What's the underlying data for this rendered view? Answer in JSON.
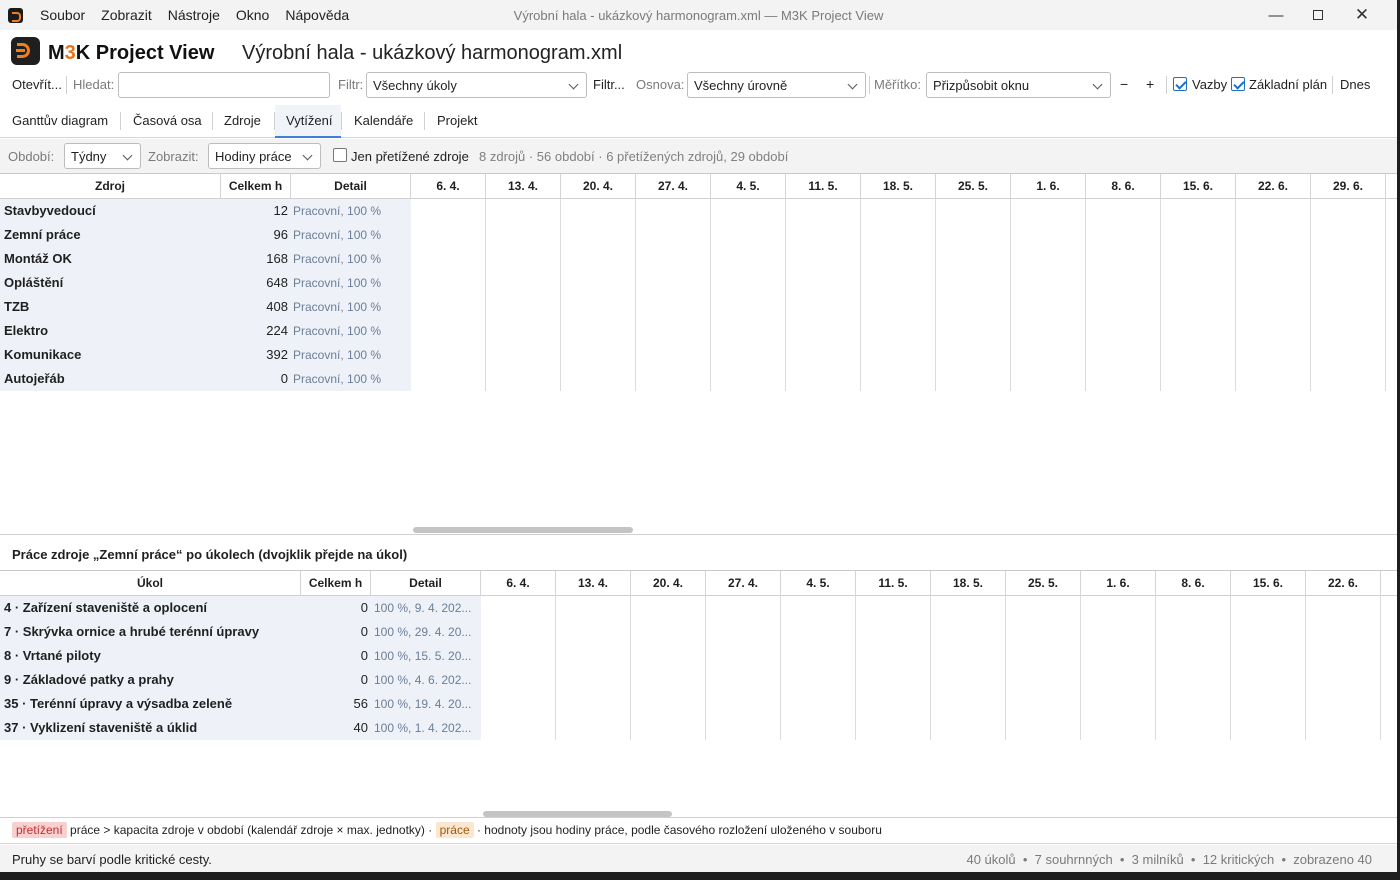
{
  "window": {
    "title": "Výrobní hala - ukázkový harmonogram.xml — M3K Project View",
    "menu": [
      "Soubor",
      "Zobrazit",
      "Nástroje",
      "Okno",
      "Nápověda"
    ]
  },
  "header": {
    "brand_prefix": "M",
    "brand_digit": "3",
    "brand_suffix": "K Project View",
    "document": "Výrobní hala - ukázkový harmonogram.xml"
  },
  "toolbar": {
    "open_label": "Otevřít...",
    "search_label": "Hledat:",
    "search_value": "",
    "filter_label": "Filtr:",
    "filter_value": "Všechny úkoly",
    "filter_more": "Filtr...",
    "outline_label": "Osnova:",
    "outline_value": "Všechny úrovně",
    "scale_label": "Měřítko:",
    "scale_value": "Přizpůsobit oknu",
    "zoom_out": "−",
    "zoom_in": "+",
    "links_label": "Vazby",
    "links_checked": true,
    "baseline_label": "Základní plán",
    "baseline_checked": true,
    "today_label": "Dnes"
  },
  "tabs": [
    "Ganttův diagram",
    "Časová osa",
    "Zdroje",
    "Vytížení",
    "Kalendáře",
    "Projekt"
  ],
  "active_tab": "Vytížení",
  "filterbar": {
    "period_label": "Období:",
    "period_value": "Týdny",
    "show_label": "Zobrazit:",
    "show_value": "Hodiny práce",
    "overloaded_only_label": "Jen přetížené zdroje",
    "overloaded_only_checked": false,
    "info": "8 zdrojů · 56 období · 6 přetížených zdrojů, 29 období"
  },
  "resources_grid": {
    "columns": [
      "Zdroj",
      "Celkem h",
      "Detail"
    ],
    "periods": [
      "6. 4.",
      "13. 4.",
      "20. 4.",
      "27. 4.",
      "4. 5.",
      "11. 5.",
      "18. 5.",
      "25. 5.",
      "1. 6.",
      "8. 6.",
      "15. 6.",
      "22. 6.",
      "29. 6."
    ],
    "rows": [
      {
        "name": "Stavbyvedoucí",
        "total": "12",
        "detail": "Pracovní, 100 %"
      },
      {
        "name": "Zemní práce",
        "total": "96",
        "detail": "Pracovní, 100 %"
      },
      {
        "name": "Montáž OK",
        "total": "168",
        "detail": "Pracovní, 100 %"
      },
      {
        "name": "Opláštění",
        "total": "648",
        "detail": "Pracovní, 100 %"
      },
      {
        "name": "TZB",
        "total": "408",
        "detail": "Pracovní, 100 %"
      },
      {
        "name": "Elektro",
        "total": "224",
        "detail": "Pracovní, 100 %"
      },
      {
        "name": "Komunikace",
        "total": "392",
        "detail": "Pracovní, 100 %"
      },
      {
        "name": "Autojeřáb",
        "total": "0",
        "detail": "Pracovní, 100 %"
      }
    ]
  },
  "detail_title": "Práce zdroje „Zemní práce“ po úkolech (dvojklik přejde na úkol)",
  "tasks_grid": {
    "columns": [
      "Úkol",
      "Celkem h",
      "Detail"
    ],
    "periods": [
      "6. 4.",
      "13. 4.",
      "20. 4.",
      "27. 4.",
      "4. 5.",
      "11. 5.",
      "18. 5.",
      "25. 5.",
      "1. 6.",
      "8. 6.",
      "15. 6.",
      "22. 6."
    ],
    "rows": [
      {
        "name": "4 · Zařízení staveniště a oplocení",
        "total": "0",
        "detail": "100 %, 9. 4. 202..."
      },
      {
        "name": "7 · Skrývka ornice a hrubé terénní úpravy",
        "total": "0",
        "detail": "100 %, 29. 4. 20..."
      },
      {
        "name": "8 · Vrtané piloty",
        "total": "0",
        "detail": "100 %, 15. 5. 20..."
      },
      {
        "name": "9 · Základové patky a prahy",
        "total": "0",
        "detail": "100 %, 4. 6. 202..."
      },
      {
        "name": "35 · Terénní úpravy a výsadba zeleně",
        "total": "56",
        "detail": "100 %, 19. 4. 20..."
      },
      {
        "name": "37 · Vyklizení staveniště a úklid",
        "total": "40",
        "detail": "100 %, 1. 4. 202..."
      }
    ]
  },
  "legend": {
    "overload_tag": "přetížení",
    "overload_text": "práce > kapacita zdroje v období (kalendář zdroje × max. jednotky) ·",
    "work_tag": "práce",
    "work_text": "· hodnoty jsou hodiny práce, podle časového rozložení uloženého v souboru"
  },
  "status": {
    "left": "Pruhy se barví podle kritické cesty.",
    "right": "40 úkolů  •  7 souhrnných  •  3 milníků  •  12 kritických  •  zobrazeno 40"
  }
}
